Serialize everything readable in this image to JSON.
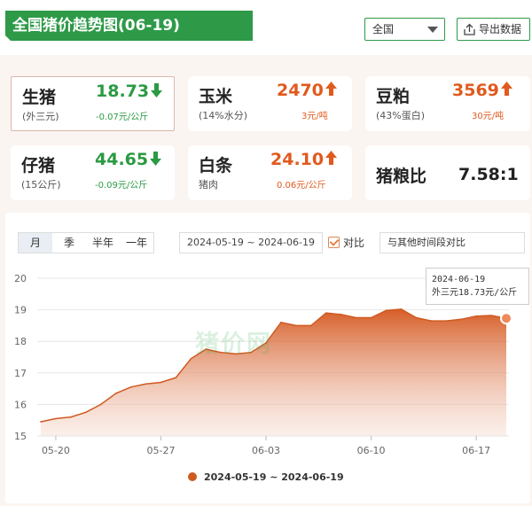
{
  "header": {
    "title": "全国猪价趋势图(06-19)",
    "region": "全国",
    "export_label": "导出数据"
  },
  "cards": [
    {
      "name": "生猪",
      "sub": "(外三元)",
      "price": "18.73",
      "change": "-0.07元/公斤",
      "direction": "down",
      "selected": true
    },
    {
      "name": "玉米",
      "sub": "(14%水分)",
      "price": "2470",
      "change": "3元/吨",
      "direction": "up"
    },
    {
      "name": "豆粕",
      "sub": "(43%蛋白)",
      "price": "3569",
      "change": "30元/吨",
      "direction": "up"
    },
    {
      "name": "仔猪",
      "sub": "(15公斤)",
      "price": "44.65",
      "change": "-0.09元/公斤",
      "direction": "down"
    },
    {
      "name": "白条",
      "sub": "猪肉",
      "price": "24.10",
      "change": "0.06元/公斤",
      "direction": "up"
    },
    {
      "name": "猪粮比",
      "sub": "",
      "price": "7.58:1",
      "change": "",
      "direction": "none"
    }
  ],
  "colors": {
    "up": "#e05a1e",
    "down": "#2a9a43",
    "accent": "#2e9a48",
    "series": "#cf5a1f"
  },
  "chart_controls": {
    "periods": [
      "月",
      "季",
      "半年",
      "一年"
    ],
    "active_period": "月",
    "date_range": "2024-05-19 ~ 2024-06-19",
    "compare_label": "对比",
    "compare_checked": true,
    "other_period_placeholder": "与其他时间段对比"
  },
  "tooltip": {
    "date": "2024-06-19",
    "value_text": "外三元18.73元/公斤"
  },
  "watermark": "猪价网",
  "chart_data": {
    "type": "area",
    "title": "",
    "xlabel": "",
    "ylabel": "",
    "ylim": [
      15,
      20
    ],
    "yticks": [
      15,
      16,
      17,
      18,
      19,
      20
    ],
    "xtick_labels": [
      "05-20",
      "05-27",
      "06-03",
      "06-10",
      "06-17"
    ],
    "grid": true,
    "legend_position": "bottom",
    "series": [
      {
        "name": "2024-05-19 ~ 2024-06-19",
        "x": [
          "05-19",
          "05-20",
          "05-21",
          "05-22",
          "05-23",
          "05-24",
          "05-25",
          "05-26",
          "05-27",
          "05-28",
          "05-29",
          "05-30",
          "05-31",
          "06-01",
          "06-02",
          "06-03",
          "06-04",
          "06-05",
          "06-06",
          "06-07",
          "06-08",
          "06-09",
          "06-10",
          "06-11",
          "06-12",
          "06-13",
          "06-14",
          "06-15",
          "06-16",
          "06-17",
          "06-18",
          "06-19"
        ],
        "values": [
          15.45,
          15.55,
          15.6,
          15.75,
          16.0,
          16.35,
          16.55,
          16.65,
          16.7,
          16.85,
          17.45,
          17.75,
          17.65,
          17.6,
          17.65,
          17.95,
          18.6,
          18.5,
          18.5,
          18.9,
          18.85,
          18.75,
          18.75,
          18.98,
          19.02,
          18.75,
          18.65,
          18.65,
          18.7,
          18.8,
          18.82,
          18.73
        ]
      }
    ]
  }
}
